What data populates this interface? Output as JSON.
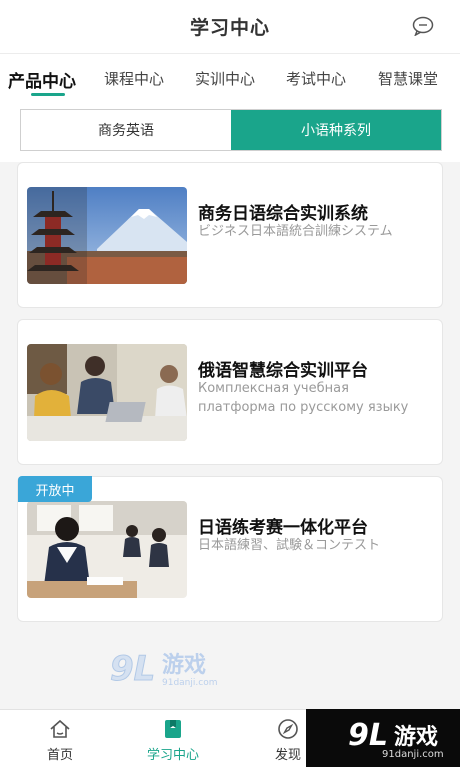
{
  "header": {
    "title": "学习中心"
  },
  "tabs": [
    {
      "label": "产品中心",
      "active": true
    },
    {
      "label": "课程中心"
    },
    {
      "label": "实训中心"
    },
    {
      "label": "考试中心"
    },
    {
      "label": "智慧课堂"
    }
  ],
  "segment": {
    "left": "商务英语",
    "right": "小语种系列",
    "active": "right"
  },
  "cards": [
    {
      "title": "商务日语综合实训系统",
      "subtitle": "ビジネス日本語統合訓練システム"
    },
    {
      "title": "俄语智慧综合实训平台",
      "subtitle": "Комплексная учебная платформа по русскому языку"
    },
    {
      "title": "日语练考赛一体化平台",
      "subtitle": "日本語練習、試験＆コンテスト",
      "badge": "开放中"
    }
  ],
  "watermark": {
    "brand": "游戏",
    "domain": "91danji.com"
  },
  "bottom_nav": [
    {
      "label": "首页"
    },
    {
      "label": "学习中心",
      "active": true
    },
    {
      "label": "发现"
    }
  ],
  "colors": {
    "accent": "#1aa58b",
    "badge": "#3aa6d8"
  }
}
